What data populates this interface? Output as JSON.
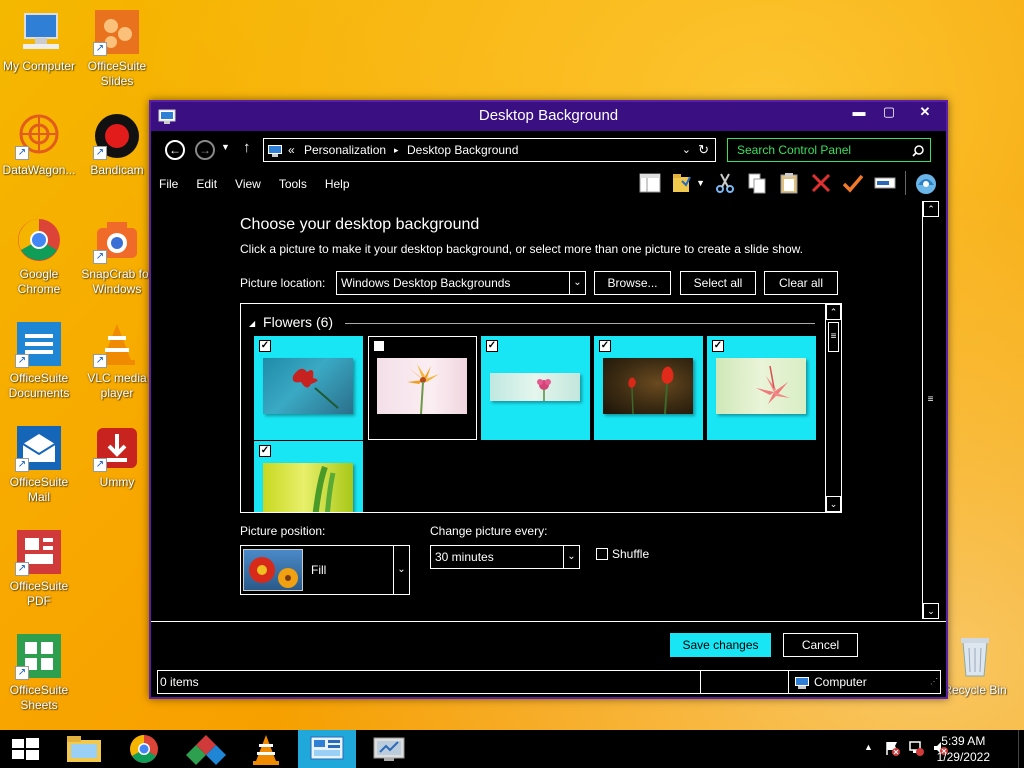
{
  "desktop": {
    "icons": [
      {
        "label": "My Computer"
      },
      {
        "label": "OfficeSuite Slides"
      },
      {
        "label": "DataWagon..."
      },
      {
        "label": "Bandicam"
      },
      {
        "label": "Google Chrome"
      },
      {
        "label": "SnapCrab for Windows"
      },
      {
        "label": "OfficeSuite Documents"
      },
      {
        "label": "VLC media player"
      },
      {
        "label": "OfficeSuite Mail"
      },
      {
        "label": "Ummy"
      },
      {
        "label": "OfficeSuite PDF"
      },
      {
        "label": "OfficeSuite Sheets"
      },
      {
        "label": "Recycle Bin"
      }
    ]
  },
  "window": {
    "title": "Desktop Background",
    "controls": {
      "minimize": "▬",
      "maximize": "▢",
      "close": "✕"
    },
    "address": {
      "prefix": "«",
      "crumbs": [
        "Personalization",
        "Desktop Background"
      ],
      "separator": "▸"
    },
    "search_placeholder": "Search Control Panel",
    "menu": [
      "File",
      "Edit",
      "View",
      "Tools",
      "Help"
    ]
  },
  "page": {
    "heading": "Choose your desktop background",
    "subheading": "Click a picture to make it your desktop background, or select more than one picture to create a slide show.",
    "picture_location_label": "Picture location:",
    "picture_location_value": "Windows Desktop Backgrounds",
    "browse_label": "Browse...",
    "select_all_label": "Select all",
    "clear_all_label": "Clear all",
    "group_label": "Flowers (6)",
    "pictures": [
      {
        "selected": true
      },
      {
        "selected": false
      },
      {
        "selected": true
      },
      {
        "selected": true
      },
      {
        "selected": true
      },
      {
        "selected": true
      }
    ],
    "picture_position_label": "Picture position:",
    "picture_position_value": "Fill",
    "change_every_label": "Change picture every:",
    "change_every_value": "30 minutes",
    "shuffle_label": "Shuffle",
    "shuffle_checked": false,
    "save_label": "Save changes",
    "cancel_label": "Cancel"
  },
  "status": {
    "items": "0 items",
    "location": "Computer"
  },
  "taskbar": {
    "time": "5:39 AM",
    "date": "1/29/2022"
  },
  "colors": {
    "accent_titlebar": "#3a0f82",
    "selection": "#19e6f5",
    "search_text": "#3adf5a"
  }
}
